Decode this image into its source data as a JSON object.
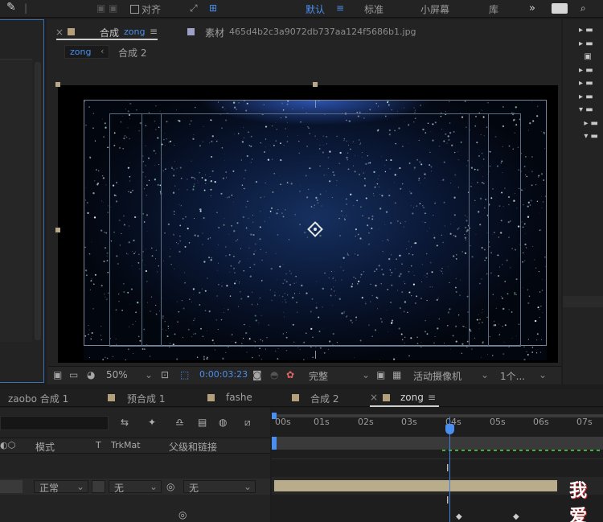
{
  "toolbar": {
    "align_checkbox_label": "对齐",
    "workspaces": [
      "默认",
      "标准",
      "小屏幕",
      "库"
    ],
    "active_workspace": "默认",
    "overflow": "»"
  },
  "comp_viewer": {
    "tab_comp_prefix": "合成",
    "tab_comp_name": "zong",
    "tab_footage_prefix": "素材",
    "tab_footage_name": "465d4b2c3a9072db737aa124f5686b1.jpg",
    "nav_current": "zong",
    "nav_next": "合成 2",
    "zoom": "50%",
    "timecode": "0:00:03:23",
    "resolution": "完整",
    "camera": "活动摄像机",
    "views": "1个..."
  },
  "timeline": {
    "tabs": [
      "zaobo 合成 1",
      "预合成 1",
      "fashe",
      "合成 2",
      "zong"
    ],
    "active_tab": "zong",
    "ruler": [
      "00s",
      "01s",
      "02s",
      "03s",
      "04s",
      "05s",
      "06s",
      "07s"
    ],
    "columns": {
      "mode": "模式",
      "t": "T",
      "trkmat": "TrkMat",
      "parent": "父级和链接"
    },
    "layer": {
      "mode": "正常",
      "trkmat": "无",
      "parent": "无"
    }
  },
  "colors": {
    "accent": "#4a8ff0",
    "panel_bg": "#232323",
    "layer_bar": "#b8ac8a",
    "comp_swatch": "#b39f7a",
    "footage_swatch": "#9ea0c8"
  },
  "watermark": "我爱"
}
